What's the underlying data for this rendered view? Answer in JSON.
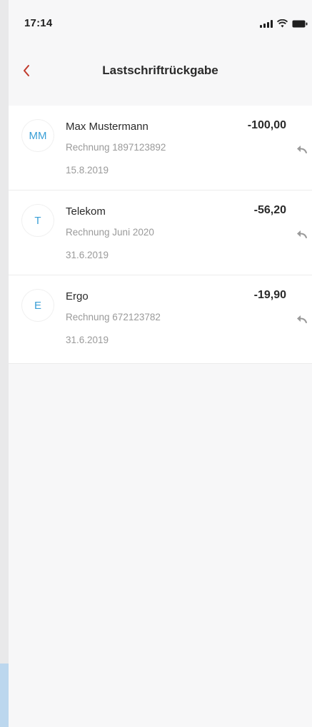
{
  "status_bar": {
    "time": "17:14"
  },
  "header": {
    "title": "Lastschriftrückgabe"
  },
  "items": [
    {
      "initials": "MM",
      "name": "Max Mustermann",
      "reference": "Rechnung 1897123892",
      "date": "15.8.2019",
      "amount": "-100,00"
    },
    {
      "initials": "T",
      "name": "Telekom",
      "reference": "Rechnung Juni 2020",
      "date": "31.6.2019",
      "amount": "-56,20"
    },
    {
      "initials": "E",
      "name": "Ergo",
      "reference": "Rechnung 672123782",
      "date": "31.6.2019",
      "amount": "-19,90"
    }
  ],
  "icons": {
    "back": "chevron-left-icon",
    "row_action": "reply-arrow-icon",
    "signal": "signal-icon",
    "wifi": "wifi-icon",
    "battery": "battery-icon"
  },
  "colors": {
    "accent": "#c0392b",
    "avatar_text": "#3a9fd6",
    "secondary_text": "#9a9a9a"
  }
}
